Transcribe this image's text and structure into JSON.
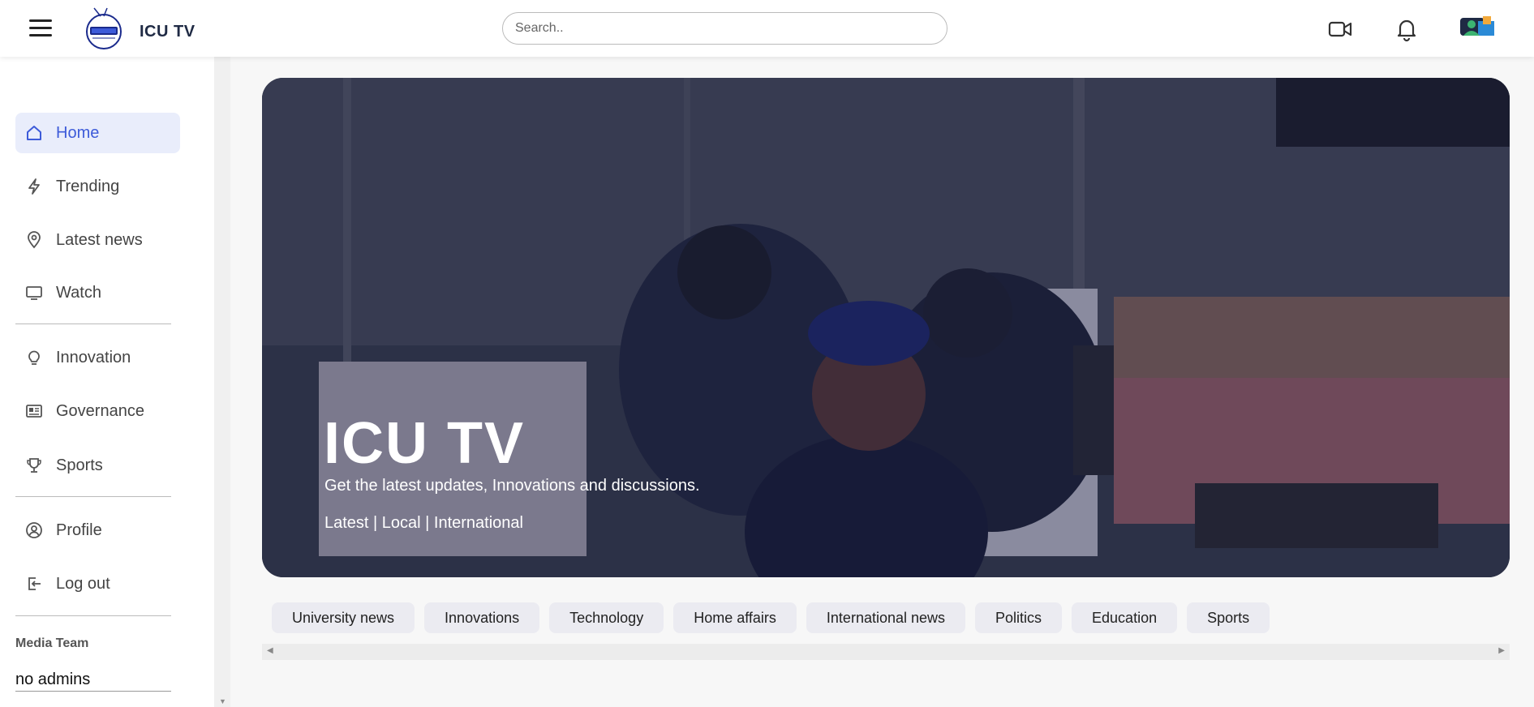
{
  "header": {
    "brand": "ICU TV",
    "search_placeholder": "Search.."
  },
  "sidebar": {
    "items": [
      {
        "label": "Home",
        "icon": "home-icon"
      },
      {
        "label": "Trending",
        "icon": "lightning-icon"
      },
      {
        "label": "Latest news",
        "icon": "location-pin-icon"
      },
      {
        "label": "Watch",
        "icon": "monitor-icon"
      },
      {
        "label": "Innovation",
        "icon": "lightbulb-icon"
      },
      {
        "label": "Governance",
        "icon": "newspaper-icon"
      },
      {
        "label": "Sports",
        "icon": "trophy-icon"
      },
      {
        "label": "Profile",
        "icon": "user-circle-icon"
      },
      {
        "label": "Log out",
        "icon": "logout-icon"
      }
    ],
    "media_team_heading": "Media Team",
    "media_team_value": "no admins"
  },
  "hero": {
    "title": "ICU TV",
    "subtitle": "Get the latest updates, Innovations and discussions.",
    "links": "Latest | Local | International"
  },
  "categories": [
    "University news",
    "Innovations",
    "Technology",
    "Home affairs",
    "International news",
    "Politics",
    "Education",
    "Sports"
  ],
  "colors": {
    "accent": "#3d5bd9",
    "active_bg": "#e9edfb",
    "chip_bg": "#ebebf1"
  }
}
